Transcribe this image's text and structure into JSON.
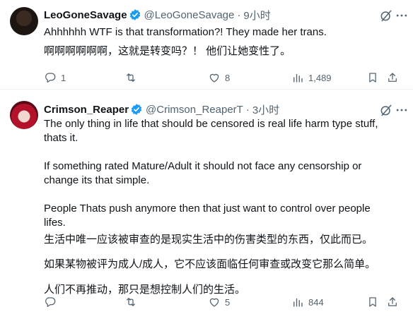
{
  "tweets": [
    {
      "name": "LeoGoneSavage",
      "handle": "@LeoGoneSavage",
      "separator": "·",
      "time": "9小时",
      "lines": [
        "Ahhhhhh WTF is that transformation?! They made her trans.",
        "啊啊啊啊啊啊，这就是转变吗？！ 他们让她变性了。"
      ],
      "replies": "1",
      "retweets": "",
      "likes": "8",
      "views": "1,489"
    },
    {
      "name": "Crimson_Reaper",
      "handle": "@Crimson_ReaperT",
      "separator": "·",
      "time": "3小时",
      "lines": [
        "The only thing in life that should be censored is real life harm type stuff, thats it.",
        "If something rated Mature/Adult it should not face any censorship or change its that simple.",
        "People Thats push anymore then that just want to control over people lifes.",
        "生活中唯一应该被审查的是现实生活中的伤害类型的东西，仅此而已。",
        "如果某物被评为成人/成人，它不应该面临任何审查或改变它那么简单。",
        "人们不再推动，那只是想控制人们的生活。"
      ],
      "replies": "",
      "retweets": "",
      "likes": "5",
      "views": "844"
    }
  ],
  "colors": {
    "verified": "#1d9bf0",
    "text": "#0f1419",
    "secondary": "#536471",
    "divider": "#eff3f4"
  }
}
